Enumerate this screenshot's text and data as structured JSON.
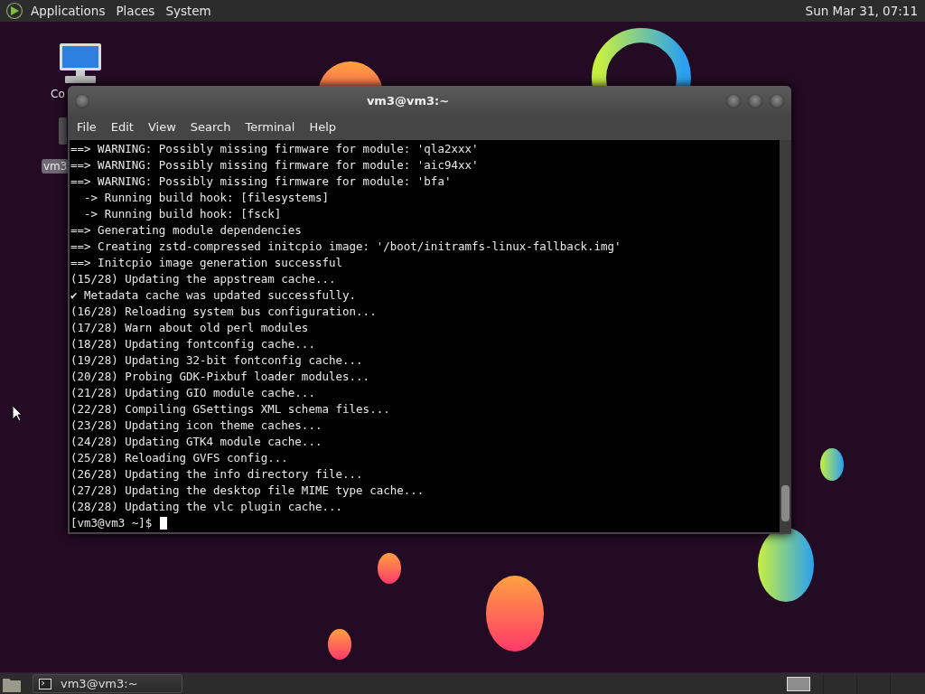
{
  "top_panel": {
    "menus": [
      "Applications",
      "Places",
      "System"
    ],
    "clock": "Sun Mar 31, 07:11"
  },
  "desktop_icons": [
    {
      "label": "Co",
      "selected": false
    },
    {
      "label": "vm3",
      "selected": true
    }
  ],
  "window": {
    "title": "vm3@vm3:~",
    "menu": [
      "File",
      "Edit",
      "View",
      "Search",
      "Terminal",
      "Help"
    ],
    "lines": [
      "==> WARNING: Possibly missing firmware for module: 'qla2xxx'",
      "==> WARNING: Possibly missing firmware for module: 'aic94xx'",
      "==> WARNING: Possibly missing firmware for module: 'bfa'",
      "  -> Running build hook: [filesystems]",
      "  -> Running build hook: [fsck]",
      "==> Generating module dependencies",
      "==> Creating zstd-compressed initcpio image: '/boot/initramfs-linux-fallback.img'",
      "==> Initcpio image generation successful",
      "(15/28) Updating the appstream cache...",
      "✔ Metadata cache was updated successfully.",
      "(16/28) Reloading system bus configuration...",
      "(17/28) Warn about old perl modules",
      "(18/28) Updating fontconfig cache...",
      "(19/28) Updating 32-bit fontconfig cache...",
      "(20/28) Probing GDK-Pixbuf loader modules...",
      "(21/28) Updating GIO module cache...",
      "(22/28) Compiling GSettings XML schema files...",
      "(23/28) Updating icon theme caches...",
      "(24/28) Updating GTK4 module cache...",
      "(25/28) Reloading GVFS config...",
      "(26/28) Updating the info directory file...",
      "(27/28) Updating the desktop file MIME type cache...",
      "(28/28) Updating the vlc plugin cache..."
    ],
    "prompt": "[vm3@vm3 ~]$"
  },
  "taskbar": {
    "tasks": [
      {
        "label": "vm3@vm3:~",
        "selected": false
      }
    ]
  }
}
